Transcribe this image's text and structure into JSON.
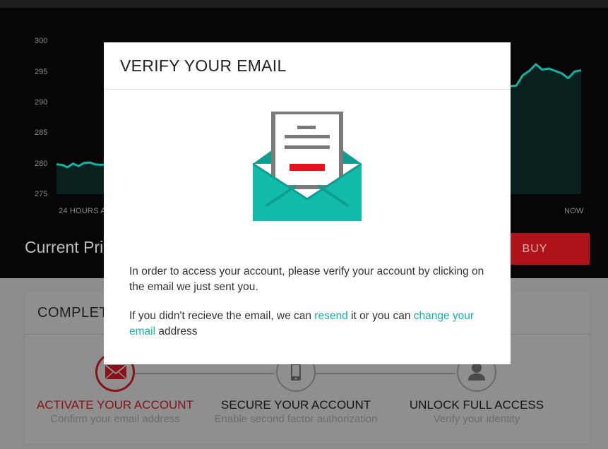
{
  "chart": {
    "y_ticks": [
      "300",
      "295",
      "290",
      "285",
      "280",
      "275"
    ],
    "x_start_label": "24 HOURS A",
    "x_end_label": "NOW"
  },
  "chart_data": {
    "type": "area",
    "ylim": [
      275,
      300
    ],
    "y_ticks": [
      300,
      295,
      290,
      285,
      280,
      275
    ],
    "x_labels": [
      "24 HOURS A",
      "NOW"
    ],
    "series_left": [
      {
        "x": 0,
        "y": 279.9
      },
      {
        "x": 1,
        "y": 279.8
      },
      {
        "x": 2,
        "y": 279.4
      },
      {
        "x": 3,
        "y": 280.0
      },
      {
        "x": 4,
        "y": 279.6
      },
      {
        "x": 5,
        "y": 280.1
      },
      {
        "x": 6,
        "y": 280.2
      },
      {
        "x": 7,
        "y": 279.9
      },
      {
        "x": 8,
        "y": 279.8
      },
      {
        "x": 9,
        "y": 279.9
      }
    ],
    "series_right": [
      {
        "x": 0,
        "y": 292.7
      },
      {
        "x": 1,
        "y": 292.8
      },
      {
        "x": 2,
        "y": 294.5
      },
      {
        "x": 3,
        "y": 295.2
      },
      {
        "x": 4,
        "y": 296.3
      },
      {
        "x": 5,
        "y": 295.4
      },
      {
        "x": 6,
        "y": 295.6
      },
      {
        "x": 7,
        "y": 295.2
      },
      {
        "x": 8,
        "y": 294.8
      },
      {
        "x": 9,
        "y": 294.0
      },
      {
        "x": 10,
        "y": 295.1
      },
      {
        "x": 11,
        "y": 295.3
      }
    ],
    "colors": {
      "line": "#13b2a2",
      "fill": "#08211e"
    }
  },
  "price": {
    "label": "Current Pri"
  },
  "buy": {
    "label": "BUY"
  },
  "steps": {
    "header": "COMPLET",
    "items": [
      {
        "title": "ACTIVATE YOUR ACCOUNT",
        "subtitle": "Confirm your email address",
        "icon": "envelope-icon",
        "active": true
      },
      {
        "title": "SECURE YOUR ACCOUNT",
        "subtitle": "Enable second factor authorization",
        "icon": "phone-icon",
        "active": false
      },
      {
        "title": "UNLOCK FULL ACCESS",
        "subtitle": "Verify your identity",
        "icon": "user-icon",
        "active": false
      }
    ]
  },
  "modal": {
    "title": "VERIFY YOUR EMAIL",
    "paragraph1": "In order to access your account, please verify your account by clicking on the email we just sent you.",
    "p2_part1": "If you didn't recieve the email, we can ",
    "p2_link1": "resend",
    "p2_part2": " it or you can ",
    "p2_link2": "change your email",
    "p2_part3": " address",
    "illustration": "open-envelope-letter-icon"
  },
  "colors": {
    "accent": "#14b4a6",
    "danger": "#e5121f",
    "active_step": "#8a1216",
    "backdrop": "#8c8c8c"
  }
}
